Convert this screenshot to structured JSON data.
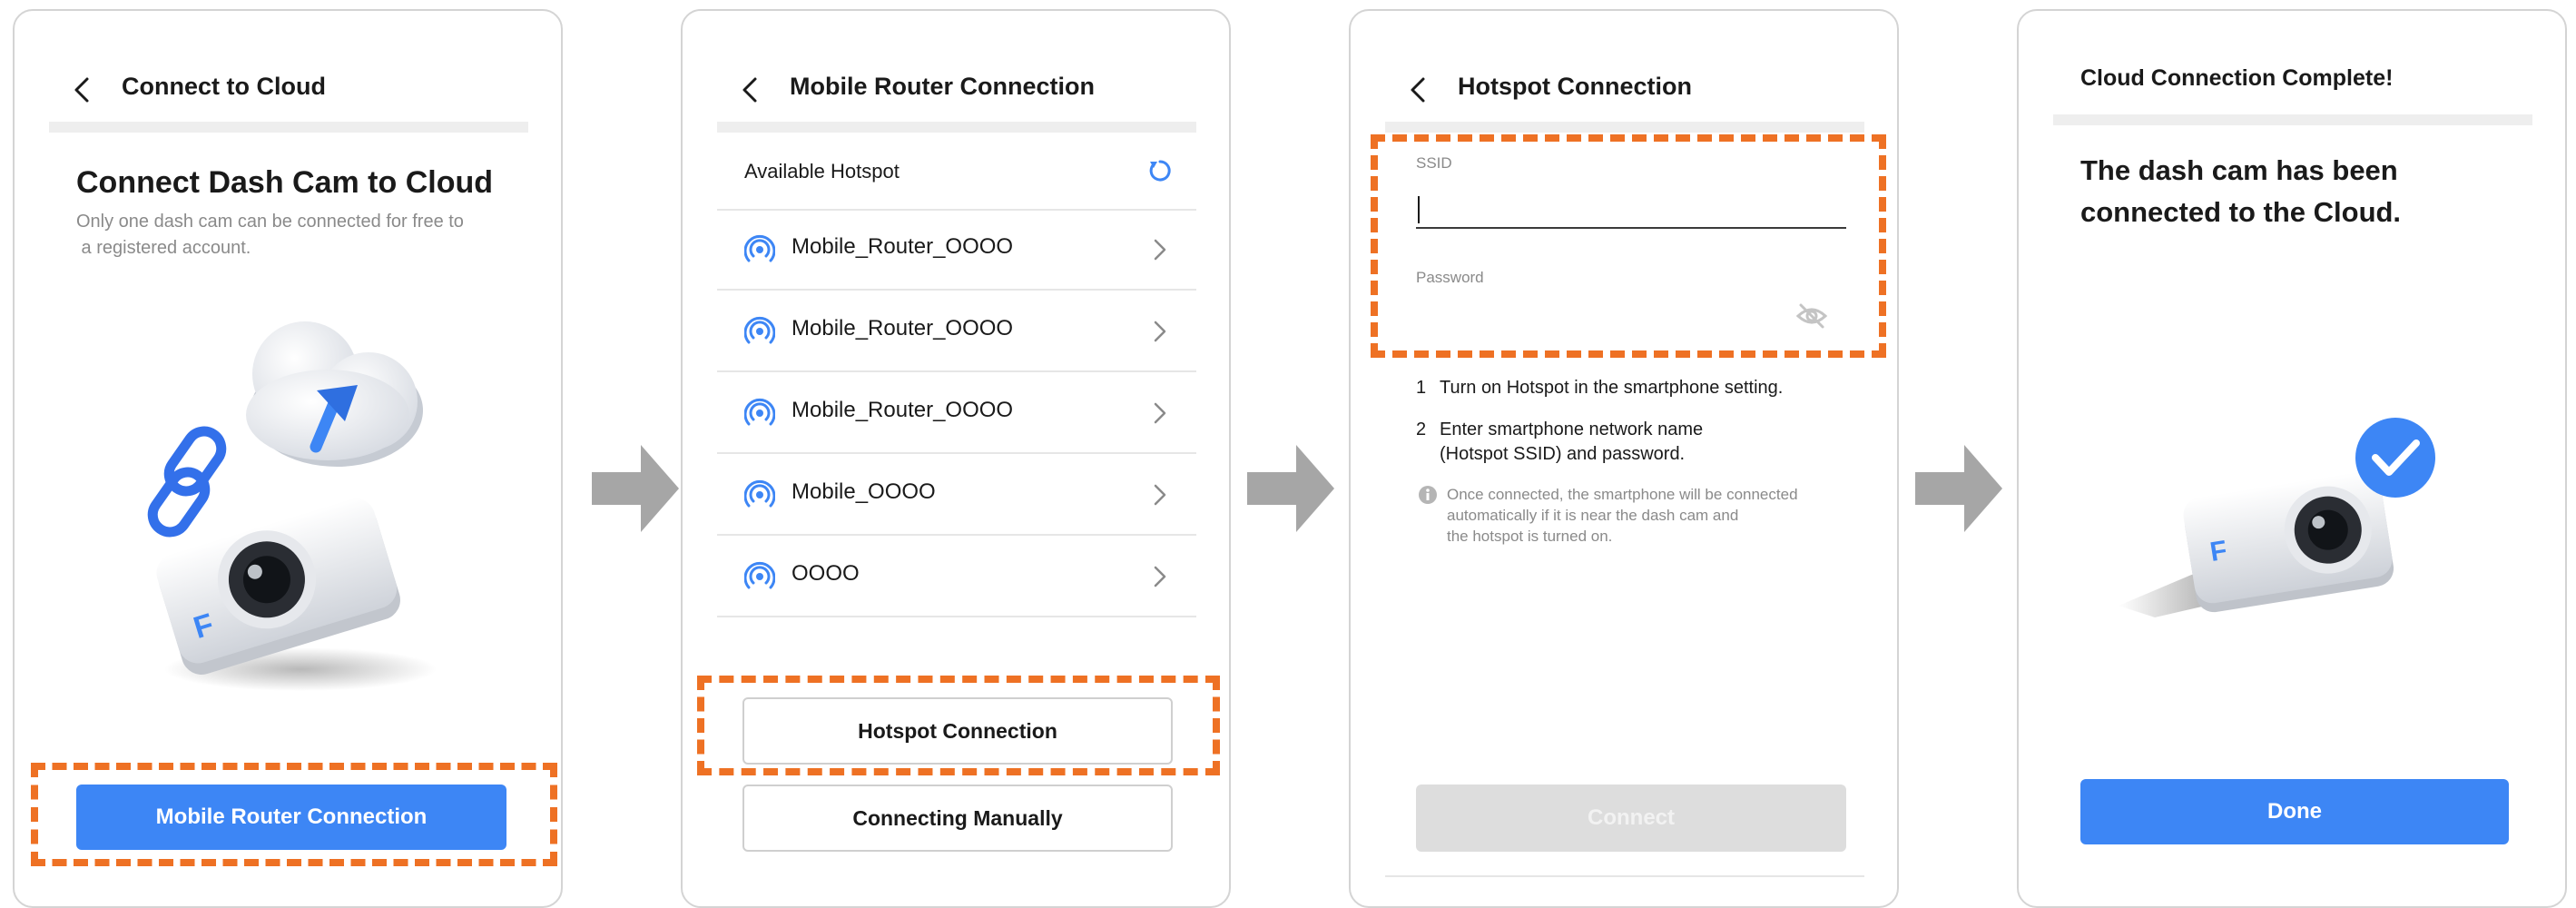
{
  "colors": {
    "accent_blue": "#3d86f5",
    "highlight_orange": "#ee7124",
    "arrow_gray": "#a6a6a6",
    "panel_border": "#d4d4d4"
  },
  "screen1": {
    "title": "Connect to Cloud",
    "heading": "Connect Dash Cam to Cloud",
    "description_line1": "Only one dash cam can be connected for free to",
    "description_line2": " a registered account.",
    "primary_button": "Mobile Router Connection",
    "logo_letter": "F"
  },
  "screen2": {
    "title": "Mobile Router Connection",
    "section_label": "Available Hotspot",
    "hotspots": [
      {
        "name": "Mobile_Router_OOOO"
      },
      {
        "name": "Mobile_Router_OOOO"
      },
      {
        "name": "Mobile_Router_OOOO"
      },
      {
        "name": "Mobile_OOOO"
      },
      {
        "name": "OOOO"
      }
    ],
    "hotspot_button": "Hotspot Connection",
    "manual_button": "Connecting Manually"
  },
  "screen3": {
    "title": "Hotspot Connection",
    "ssid_label": "SSID",
    "ssid_value": "",
    "password_label": "Password",
    "password_value": "",
    "steps": [
      {
        "num": "1",
        "line1": "Turn on Hotspot in the smartphone setting.",
        "line2": ""
      },
      {
        "num": "2",
        "line1": "Enter smartphone network name",
        "line2": "(Hotspot SSID) and password."
      }
    ],
    "info_line1": "Once connected, the smartphone will be connected",
    "info_line2": "automatically if it is near the dash cam and",
    "info_line3": "the hotspot is turned on.",
    "connect_button": "Connect"
  },
  "screen4": {
    "title": "Cloud Connection Complete!",
    "message_line1": "The dash cam has been",
    "message_line2": "connected to the Cloud.",
    "done_button": "Done",
    "logo_letter": "F"
  }
}
